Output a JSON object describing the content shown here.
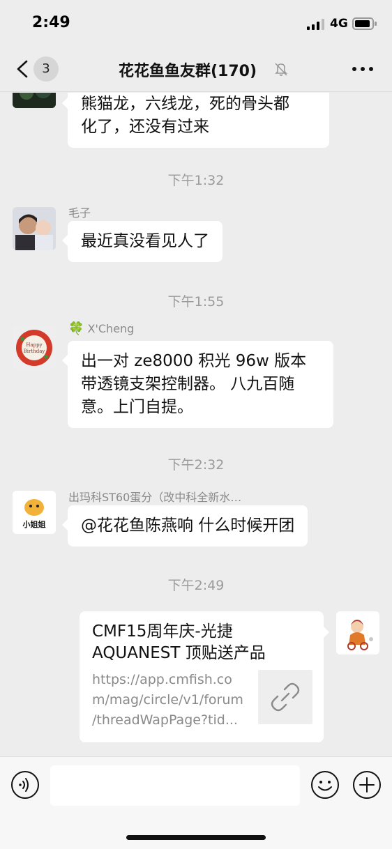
{
  "status_bar": {
    "time": "2:49",
    "network": "4G"
  },
  "nav": {
    "unread_count": "3",
    "title": "花花鱼鱼友群(170)",
    "icons": {
      "back": "chevron-left-icon",
      "mute": "bell-off-icon",
      "more": "more-dots-icon"
    }
  },
  "messages": {
    "m1": {
      "text_line1": "熊猫龙，六线龙，死的骨头都",
      "text_line2": "化了，还没有过来"
    },
    "ts1": "下午1:32",
    "m2": {
      "sender": "毛子",
      "text": "最近真没看见人了"
    },
    "ts2": "下午1:55",
    "m3": {
      "sender_icon": "🍀",
      "sender": "X'Cheng",
      "text_line1": "出一对 ze8000 积光 96w 版本",
      "text_line2": "带透镜支架控制器。 八九百随",
      "text_line3": "意。上门自提。",
      "avatar_text_1": "Happy",
      "avatar_text_2": "Birthday"
    },
    "ts3": "下午2:32",
    "m4": {
      "sender": "出玛科ST60蛋分（改中科全新水…",
      "text": "@花花鱼陈燕响 什么时候开团",
      "avatar_label": "小姐姐"
    },
    "ts4": "下午2:49",
    "m5": {
      "card_title_line1": "CMF15周年庆-光捷",
      "card_title_line2": "AQUANEST 顶贴送产品",
      "card_url_line1": "https://app.cmfish.co",
      "card_url_line2": "m/mag/circle/v1/forum",
      "card_url_line3": "/threadWapPage?tid...",
      "thumb_icon": "link-icon"
    }
  },
  "input_bar": {
    "message_value": "",
    "icons": {
      "voice": "voice-icon",
      "emoji": "emoji-icon",
      "plus": "plus-icon"
    }
  },
  "colors": {
    "background": "#ededed",
    "bubble": "#ffffff",
    "timestamp": "#9a9a9a",
    "sender": "#8a8a8a"
  }
}
